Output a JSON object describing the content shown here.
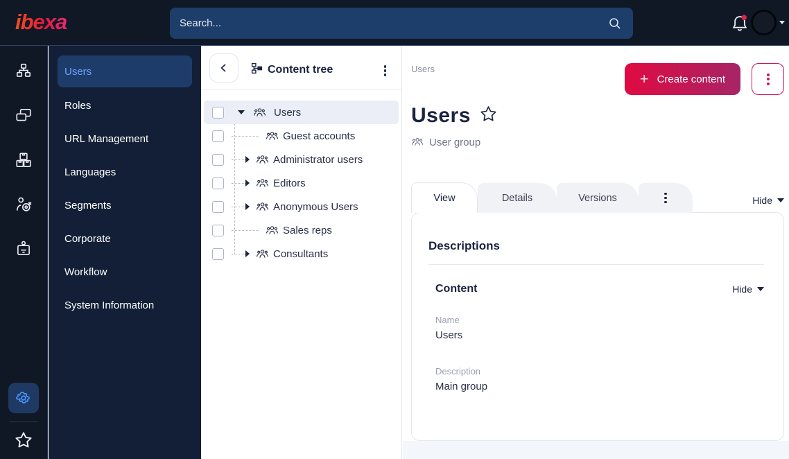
{
  "topbar": {
    "logo_text": "ibexa",
    "search_placeholder": "Search..."
  },
  "rail": {
    "icons": [
      "content-structure",
      "pages",
      "commerce",
      "personalization",
      "admin"
    ],
    "bottom_icons": [
      "settings",
      "bookmarks"
    ]
  },
  "sidebar": {
    "items": [
      {
        "label": "Users",
        "active": true
      },
      {
        "label": "Roles",
        "active": false
      },
      {
        "label": "URL Management",
        "active": false
      },
      {
        "label": "Languages",
        "active": false
      },
      {
        "label": "Segments",
        "active": false
      },
      {
        "label": "Corporate",
        "active": false
      },
      {
        "label": "Workflow",
        "active": false
      },
      {
        "label": "System Information",
        "active": false
      }
    ]
  },
  "tree": {
    "title": "Content tree",
    "items": [
      {
        "label": "Users",
        "caret": "down",
        "selected": true
      },
      {
        "label": "Guest accounts",
        "caret": "none",
        "selected": false
      },
      {
        "label": "Administrator users",
        "caret": "right",
        "selected": false
      },
      {
        "label": "Editors",
        "caret": "right",
        "selected": false
      },
      {
        "label": "Anonymous Users",
        "caret": "right",
        "selected": false
      },
      {
        "label": "Sales reps",
        "caret": "none",
        "selected": false
      },
      {
        "label": "Consultants",
        "caret": "right",
        "selected": false
      }
    ]
  },
  "main": {
    "breadcrumb": "Users",
    "create_button_label": "Create content",
    "title": "Users",
    "content_type": "User group",
    "tabs": [
      {
        "label": "View",
        "active": true
      },
      {
        "label": "Details",
        "active": false
      },
      {
        "label": "Versions",
        "active": false
      }
    ],
    "hide_label": "Hide",
    "card": {
      "descriptions_title": "Descriptions",
      "content_title": "Content",
      "content_hide_label": "Hide",
      "fields": [
        {
          "label": "Name",
          "value": "Users"
        },
        {
          "label": "Description",
          "value": "Main group"
        }
      ]
    }
  },
  "colors": {
    "topbar_bg": "#101826",
    "sidebar_bg": "#121f36",
    "selected_item_bg": "#1d3c6a",
    "selected_item_text": "#6ea2ff",
    "search_bg": "#1d3e6a",
    "accent_red": "#db0032",
    "create_gradient_start": "#e00a41",
    "create_gradient_end": "#a62567",
    "notification_badge": "#e0244a",
    "tree_selected_row": "#eceef7"
  }
}
